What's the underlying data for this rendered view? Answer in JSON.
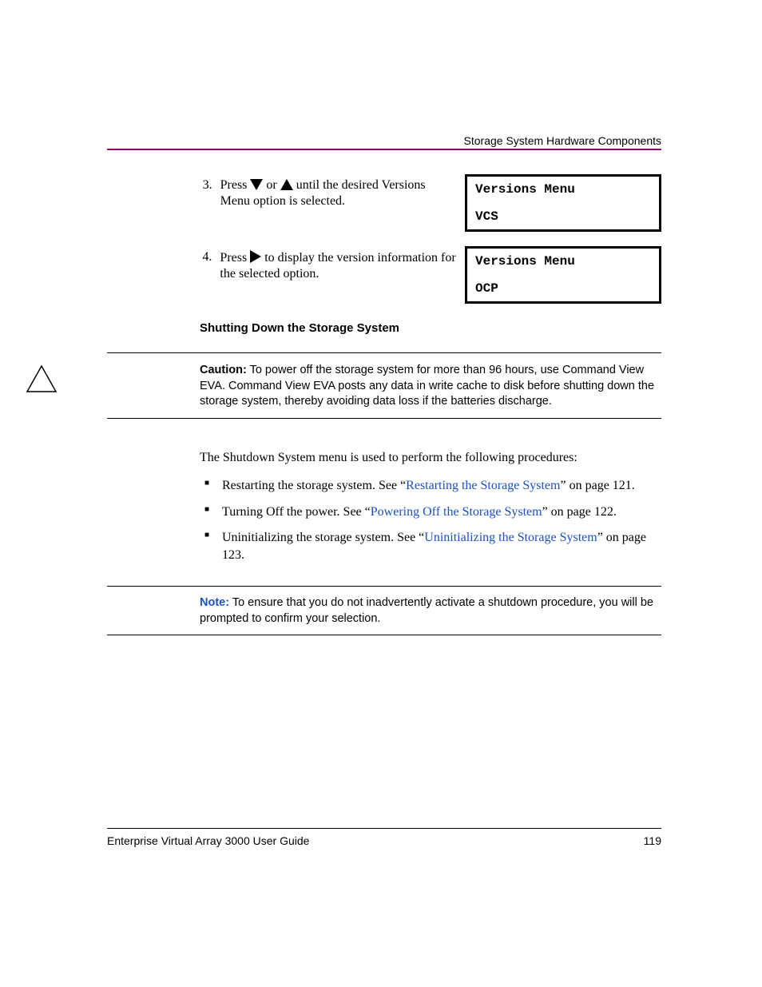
{
  "header": {
    "running_title": "Storage System Hardware Components"
  },
  "steps": [
    {
      "number": "3.",
      "prefix": "Press ",
      "mid": " or ",
      "suffix": " until the desired Versions Menu option is selected.",
      "lcd": {
        "line1": "Versions Menu",
        "line2": "VCS"
      }
    },
    {
      "number": "4.",
      "prefix": "Press ",
      "suffix": " to display the version information for the selected option.",
      "lcd": {
        "line1": "Versions Menu",
        "line2": "OCP"
      }
    }
  ],
  "section_title": "Shutting Down the Storage System",
  "caution": {
    "label": "Caution:",
    "text": "To power off the storage system for more than 96 hours, use Command View EVA. Command View EVA posts any data in write cache to disk before shutting down the storage system, thereby avoiding data loss if the batteries discharge."
  },
  "intro": "The Shutdown System menu is used to perform the following procedures:",
  "bullets": [
    {
      "pre": "Restarting the storage system. See “",
      "link": "Restarting the Storage System",
      "post": "” on page 121."
    },
    {
      "pre": "Turning Off the power. See “",
      "link": "Powering Off the Storage System",
      "post": "” on page 122."
    },
    {
      "pre": "Uninitializing the storage system. See “",
      "link": "Uninitializing the Storage System",
      "post": "” on page 123."
    }
  ],
  "note": {
    "label": "Note:",
    "text": "To ensure that you do not inadvertently activate a shutdown procedure, you will be prompted to confirm your selection."
  },
  "footer": {
    "doc_title": "Enterprise Virtual Array 3000 User Guide",
    "page_number": "119"
  }
}
